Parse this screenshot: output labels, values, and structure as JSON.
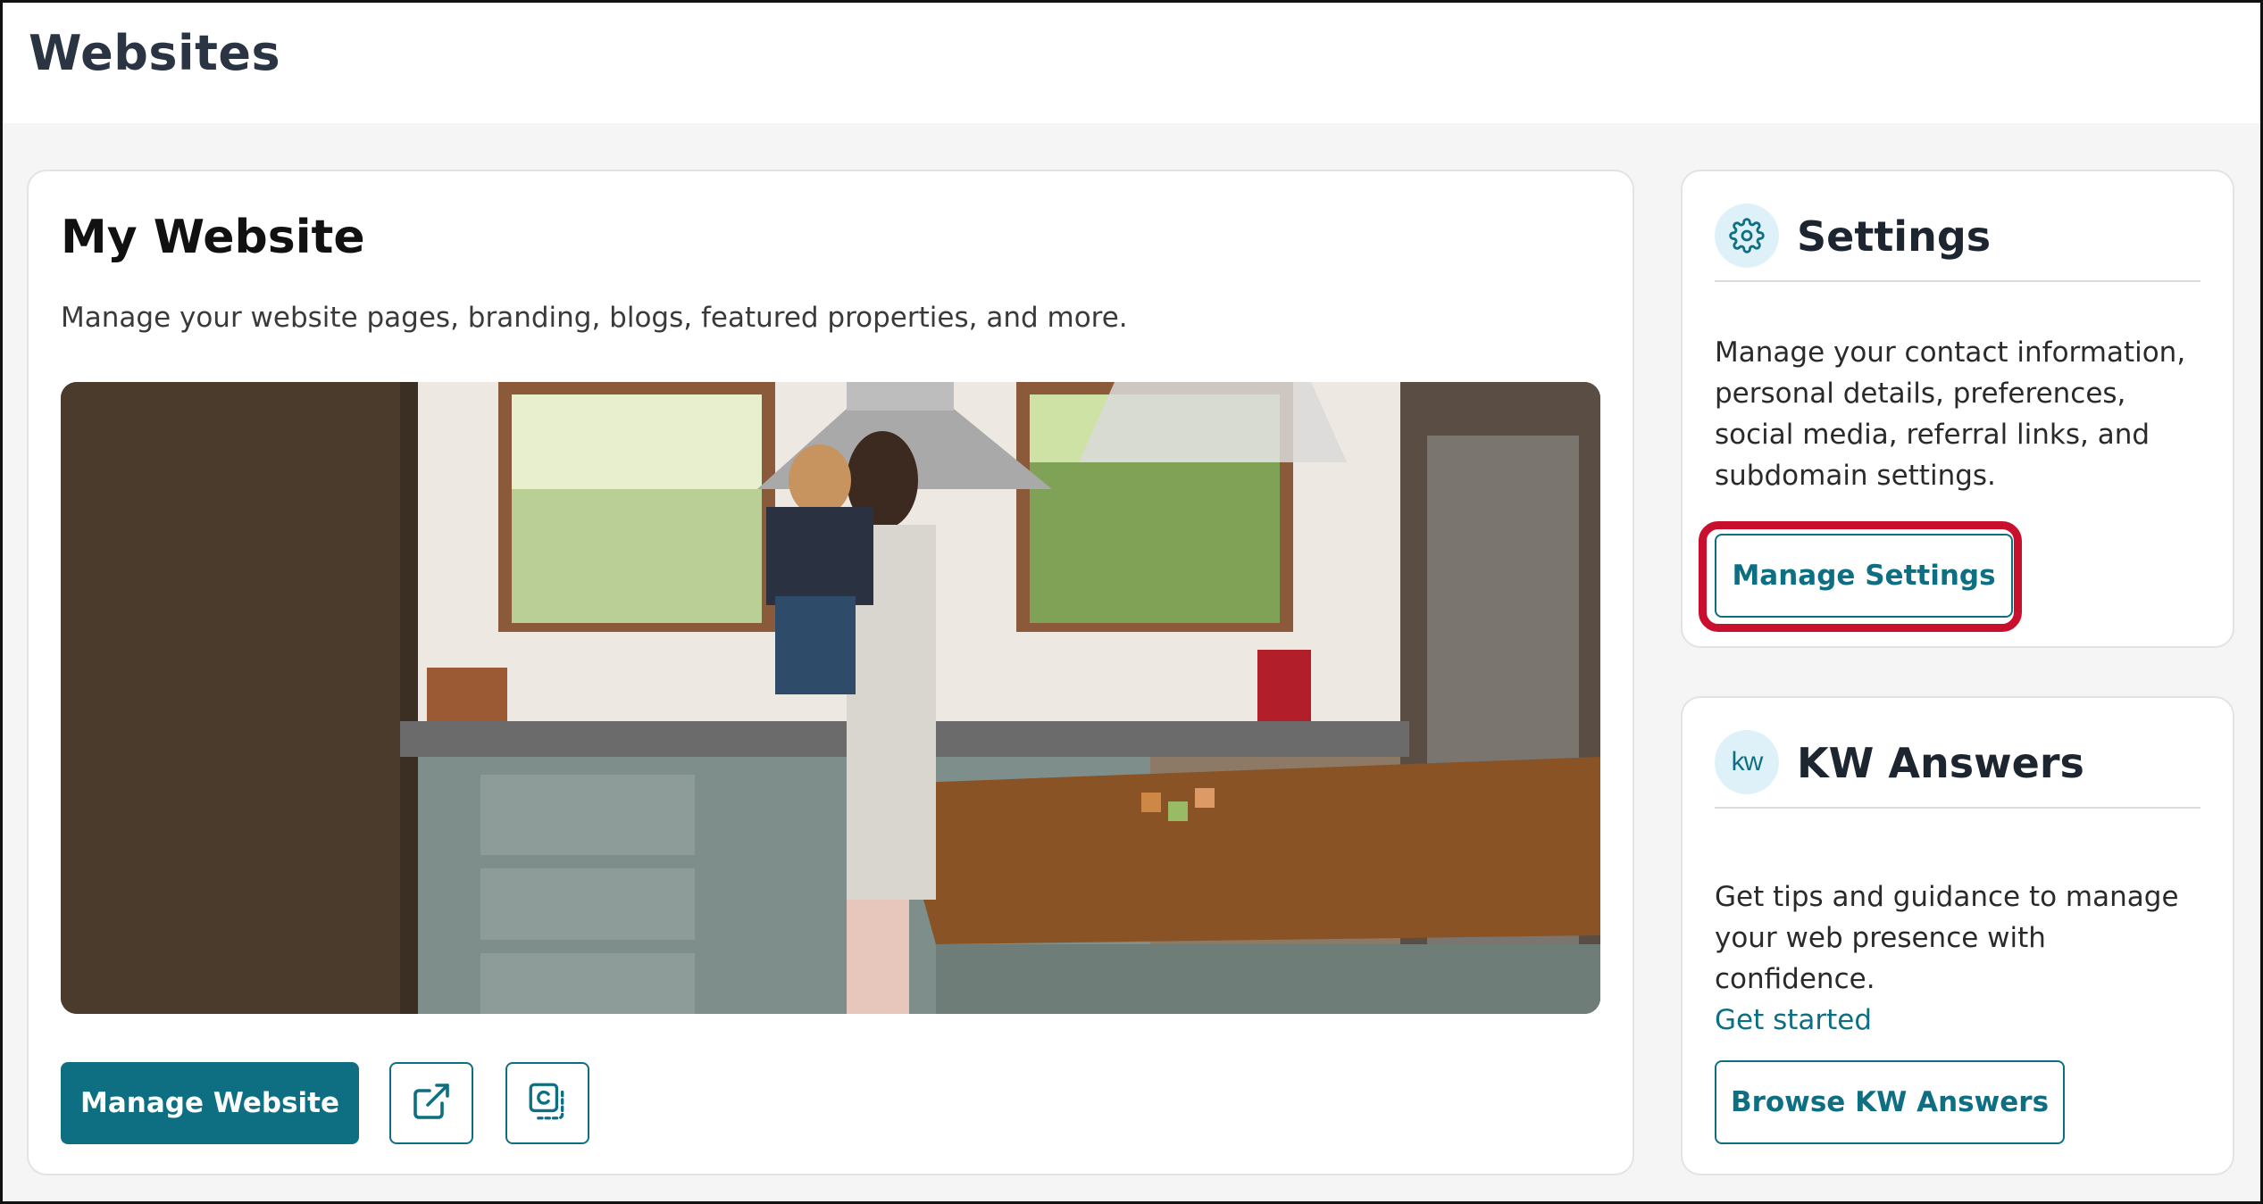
{
  "page": {
    "title": "Websites"
  },
  "main_card": {
    "title": "My Website",
    "description": "Manage your website pages, branding, blogs, featured properties, and more.",
    "hero_image": "kitchen-mother-child-photo",
    "primary_button": "Manage Website",
    "external_link_icon": "external-link-icon",
    "copy_icon": "copy-link-icon"
  },
  "settings_card": {
    "icon": "gear-icon",
    "title": "Settings",
    "description": "Manage your contact information, personal details, preferences, social media, referral links, and subdomain settings.",
    "button": "Manage Settings",
    "highlight_color": "#c8102e"
  },
  "kw_card": {
    "icon": "kw-logo-icon",
    "icon_text": "kw",
    "title": "KW Answers",
    "description": "Get tips and guidance to manage your web presence with confidence.",
    "link": "Get started",
    "button": "Browse KW Answers"
  },
  "colors": {
    "accent": "#0f6f82",
    "icon_bg": "#dff1f8",
    "page_bg": "#f5f5f5"
  }
}
